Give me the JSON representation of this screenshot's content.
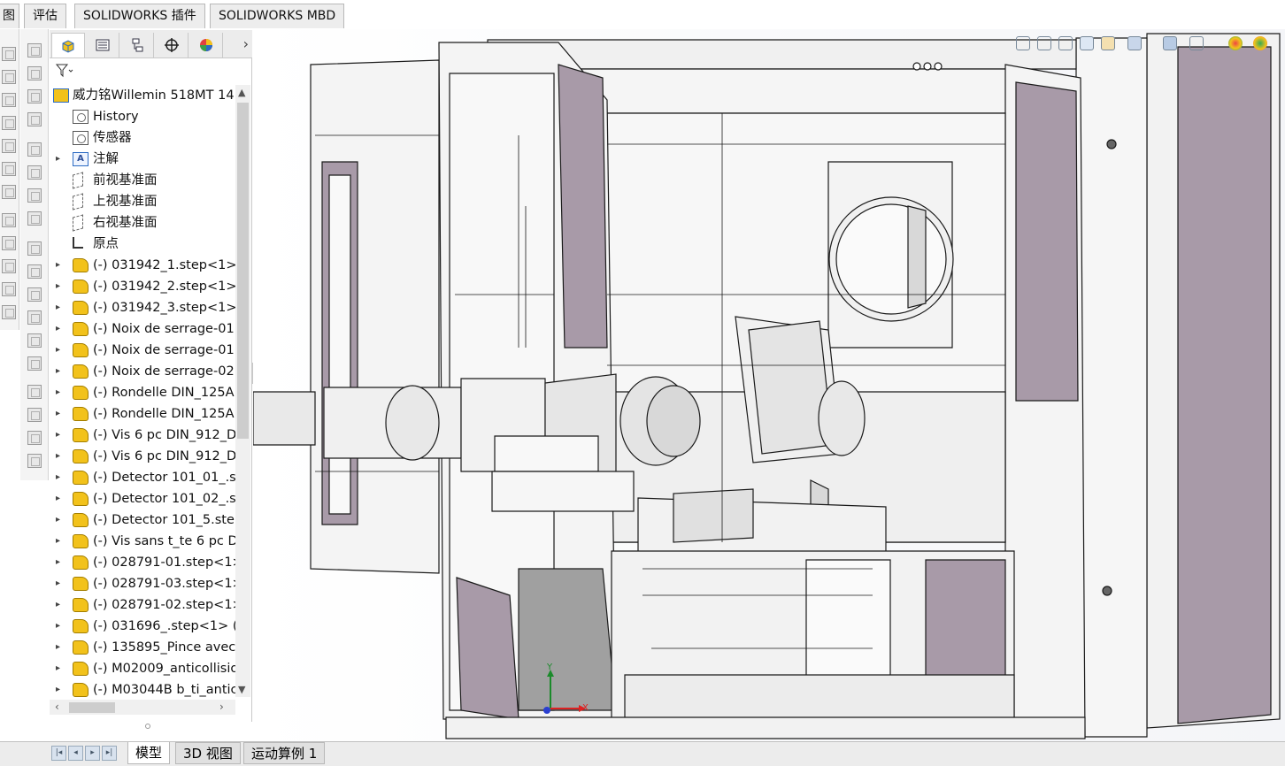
{
  "top_tabs": [
    {
      "label": "图"
    },
    {
      "label": "评估"
    },
    {
      "label": "SOLIDWORKS 插件"
    },
    {
      "label": "SOLIDWORKS MBD"
    }
  ],
  "panel": {
    "tab_icons": [
      "feature-manager-icon",
      "property-manager-icon",
      "configuration-manager-icon",
      "dimxpert-icon",
      "display-manager-icon"
    ],
    "more_glyph": "›",
    "filter_glyph": "⛛",
    "tree": [
      {
        "label": "威力铭Willemin 518MT 14",
        "icon": "assembly",
        "arrow": ""
      },
      {
        "label": "History",
        "icon": "folder",
        "arrow": ""
      },
      {
        "label": "传感器",
        "icon": "folder",
        "arrow": ""
      },
      {
        "label": "注解",
        "icon": "annotation",
        "arrow": "▸"
      },
      {
        "label": "前视基准面",
        "icon": "plane",
        "arrow": ""
      },
      {
        "label": "上视基准面",
        "icon": "plane",
        "arrow": ""
      },
      {
        "label": "右视基准面",
        "icon": "plane",
        "arrow": ""
      },
      {
        "label": "原点",
        "icon": "origin",
        "arrow": ""
      },
      {
        "label": "(-) 031942_1.step<1>",
        "icon": "part",
        "arrow": "▸"
      },
      {
        "label": "(-) 031942_2.step<1>",
        "icon": "part",
        "arrow": "▸"
      },
      {
        "label": "(-) 031942_3.step<1>",
        "icon": "part",
        "arrow": "▸"
      },
      {
        "label": "(-) Noix de serrage-01",
        "icon": "part",
        "arrow": "▸"
      },
      {
        "label": "(-) Noix de serrage-01",
        "icon": "part",
        "arrow": "▸"
      },
      {
        "label": "(-) Noix de serrage-02",
        "icon": "part",
        "arrow": "▸"
      },
      {
        "label": "(-) Rondelle DIN_125A",
        "icon": "part",
        "arrow": "▸"
      },
      {
        "label": "(-) Rondelle DIN_125A",
        "icon": "part",
        "arrow": "▸"
      },
      {
        "label": "(-) Vis 6 pc DIN_912_D",
        "icon": "part",
        "arrow": "▸"
      },
      {
        "label": "(-) Vis 6 pc DIN_912_D",
        "icon": "part",
        "arrow": "▸"
      },
      {
        "label": "(-) Detector 101_01_.s",
        "icon": "part",
        "arrow": "▸"
      },
      {
        "label": "(-) Detector 101_02_.s",
        "icon": "part",
        "arrow": "▸"
      },
      {
        "label": "(-) Detector 101_5.ste",
        "icon": "part",
        "arrow": "▸"
      },
      {
        "label": "(-) Vis sans t_te 6 pc D",
        "icon": "part",
        "arrow": "▸"
      },
      {
        "label": "(-) 028791-01.step<1>",
        "icon": "part",
        "arrow": "▸"
      },
      {
        "label": "(-) 028791-03.step<1>",
        "icon": "part",
        "arrow": "▸"
      },
      {
        "label": "(-) 028791-02.step<1>",
        "icon": "part",
        "arrow": "▸"
      },
      {
        "label": "(-) 031696_.step<1> (",
        "icon": "part",
        "arrow": "▸"
      },
      {
        "label": "(-) 135895_Pince avec",
        "icon": "part",
        "arrow": "▸"
      },
      {
        "label": "(-) M02009_anticollisio",
        "icon": "part",
        "arrow": "▸"
      },
      {
        "label": "(-) M03044B b_ti_antic",
        "icon": "part",
        "arrow": "▸"
      }
    ]
  },
  "bottom_tabs": [
    {
      "label": "模型"
    },
    {
      "label": "3D 视图"
    },
    {
      "label": "运动算例 1"
    }
  ],
  "triad": {
    "y_label": "Y",
    "x_label": "X",
    "y_color": "#1a8a2a",
    "x_color": "#d22",
    "z_color": "#2a3fd0"
  },
  "colors": {
    "machine_panel": "#a89aa8",
    "machine_line": "#1a1a1a",
    "machine_face": "#efefef"
  }
}
